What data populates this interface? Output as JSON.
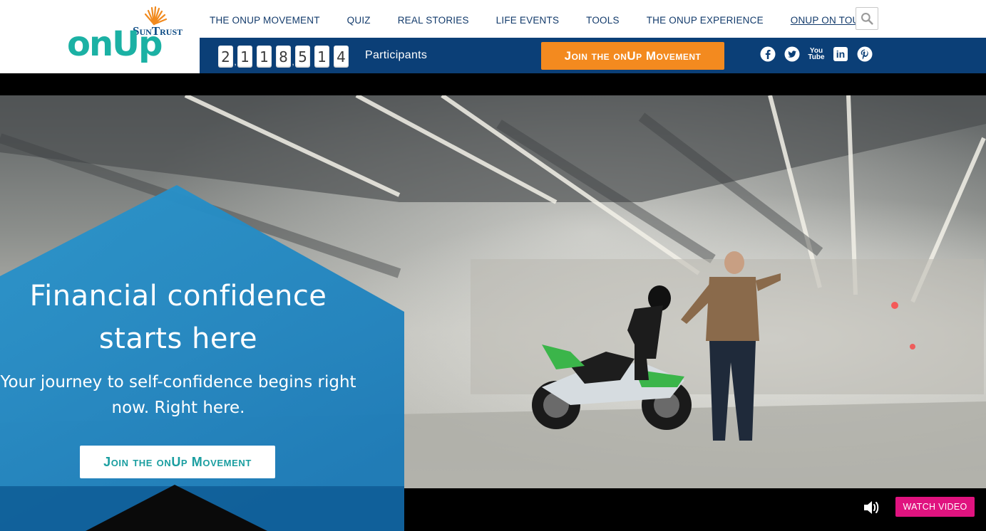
{
  "logo": {
    "brand_text": "SunTrust",
    "wordmark_text": "onUp"
  },
  "nav": {
    "items": [
      {
        "label": "THE ONUP MOVEMENT"
      },
      {
        "label": "QUIZ"
      },
      {
        "label": "REAL STORIES"
      },
      {
        "label": "LIFE EVENTS"
      },
      {
        "label": "TOOLS"
      },
      {
        "label": "THE ONUP EXPERIENCE"
      },
      {
        "label": "ONUP ON TOUR"
      }
    ],
    "search_icon": "search-icon"
  },
  "counter": {
    "digits": [
      "2",
      "1",
      "1",
      "8",
      "5",
      "1",
      "4"
    ],
    "label": "Participants"
  },
  "top_cta": {
    "label": "Join the onUp Movement"
  },
  "social": {
    "icons": [
      "facebook-icon",
      "twitter-icon",
      "youtube-icon",
      "linkedin-icon",
      "pinterest-icon"
    ],
    "youtube_text": "You Tube",
    "linkedin_text": "in"
  },
  "hero": {
    "headline": "Financial confidence starts here",
    "subhead": "Your journey to self-confidence begins right now. Right here.",
    "cta_label": "Join the onUp Movement",
    "watch_video_label": "WATCH VIDEO",
    "sound_icon": "speaker-icon"
  },
  "colors": {
    "brand_teal": "#1bb1a4",
    "navy_bar": "#0b3f77",
    "orange_cta": "#f38a1f",
    "hero_blue": "#1f86c2",
    "watch_pink": "#e0137f"
  }
}
